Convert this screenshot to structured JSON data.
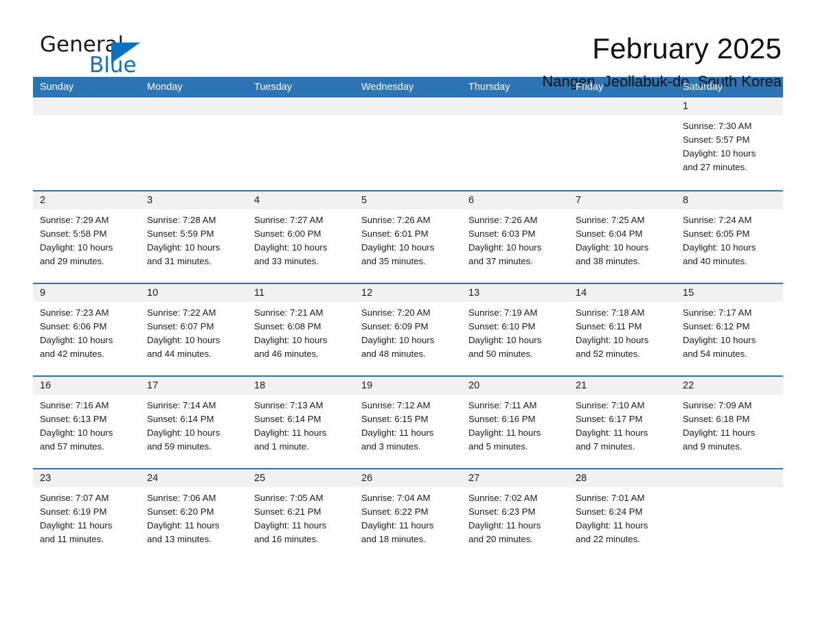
{
  "brand": {
    "name_part1": "General",
    "name_part2": "Blue",
    "accent_color": "#1170bd",
    "triangle_icon": "triangle-icon"
  },
  "header": {
    "title": "February 2025",
    "subtitle": "Nangen, Jeollabuk-do, South Korea",
    "header_bg_color": "#2d74b5",
    "day_band_color": "#f1f1f1"
  },
  "weekday_headers": [
    "Sunday",
    "Monday",
    "Tuesday",
    "Wednesday",
    "Thursday",
    "Friday",
    "Saturday"
  ],
  "weeks": [
    [
      {
        "day": "",
        "sunrise": "",
        "sunset": "",
        "daylight_line1": "",
        "daylight_line2": ""
      },
      {
        "day": "",
        "sunrise": "",
        "sunset": "",
        "daylight_line1": "",
        "daylight_line2": ""
      },
      {
        "day": "",
        "sunrise": "",
        "sunset": "",
        "daylight_line1": "",
        "daylight_line2": ""
      },
      {
        "day": "",
        "sunrise": "",
        "sunset": "",
        "daylight_line1": "",
        "daylight_line2": ""
      },
      {
        "day": "",
        "sunrise": "",
        "sunset": "",
        "daylight_line1": "",
        "daylight_line2": ""
      },
      {
        "day": "",
        "sunrise": "",
        "sunset": "",
        "daylight_line1": "",
        "daylight_line2": ""
      },
      {
        "day": "1",
        "sunrise": "Sunrise: 7:30 AM",
        "sunset": "Sunset: 5:57 PM",
        "daylight_line1": "Daylight: 10 hours",
        "daylight_line2": "and 27 minutes."
      }
    ],
    [
      {
        "day": "2",
        "sunrise": "Sunrise: 7:29 AM",
        "sunset": "Sunset: 5:58 PM",
        "daylight_line1": "Daylight: 10 hours",
        "daylight_line2": "and 29 minutes."
      },
      {
        "day": "3",
        "sunrise": "Sunrise: 7:28 AM",
        "sunset": "Sunset: 5:59 PM",
        "daylight_line1": "Daylight: 10 hours",
        "daylight_line2": "and 31 minutes."
      },
      {
        "day": "4",
        "sunrise": "Sunrise: 7:27 AM",
        "sunset": "Sunset: 6:00 PM",
        "daylight_line1": "Daylight: 10 hours",
        "daylight_line2": "and 33 minutes."
      },
      {
        "day": "5",
        "sunrise": "Sunrise: 7:26 AM",
        "sunset": "Sunset: 6:01 PM",
        "daylight_line1": "Daylight: 10 hours",
        "daylight_line2": "and 35 minutes."
      },
      {
        "day": "6",
        "sunrise": "Sunrise: 7:26 AM",
        "sunset": "Sunset: 6:03 PM",
        "daylight_line1": "Daylight: 10 hours",
        "daylight_line2": "and 37 minutes."
      },
      {
        "day": "7",
        "sunrise": "Sunrise: 7:25 AM",
        "sunset": "Sunset: 6:04 PM",
        "daylight_line1": "Daylight: 10 hours",
        "daylight_line2": "and 38 minutes."
      },
      {
        "day": "8",
        "sunrise": "Sunrise: 7:24 AM",
        "sunset": "Sunset: 6:05 PM",
        "daylight_line1": "Daylight: 10 hours",
        "daylight_line2": "and 40 minutes."
      }
    ],
    [
      {
        "day": "9",
        "sunrise": "Sunrise: 7:23 AM",
        "sunset": "Sunset: 6:06 PM",
        "daylight_line1": "Daylight: 10 hours",
        "daylight_line2": "and 42 minutes."
      },
      {
        "day": "10",
        "sunrise": "Sunrise: 7:22 AM",
        "sunset": "Sunset: 6:07 PM",
        "daylight_line1": "Daylight: 10 hours",
        "daylight_line2": "and 44 minutes."
      },
      {
        "day": "11",
        "sunrise": "Sunrise: 7:21 AM",
        "sunset": "Sunset: 6:08 PM",
        "daylight_line1": "Daylight: 10 hours",
        "daylight_line2": "and 46 minutes."
      },
      {
        "day": "12",
        "sunrise": "Sunrise: 7:20 AM",
        "sunset": "Sunset: 6:09 PM",
        "daylight_line1": "Daylight: 10 hours",
        "daylight_line2": "and 48 minutes."
      },
      {
        "day": "13",
        "sunrise": "Sunrise: 7:19 AM",
        "sunset": "Sunset: 6:10 PM",
        "daylight_line1": "Daylight: 10 hours",
        "daylight_line2": "and 50 minutes."
      },
      {
        "day": "14",
        "sunrise": "Sunrise: 7:18 AM",
        "sunset": "Sunset: 6:11 PM",
        "daylight_line1": "Daylight: 10 hours",
        "daylight_line2": "and 52 minutes."
      },
      {
        "day": "15",
        "sunrise": "Sunrise: 7:17 AM",
        "sunset": "Sunset: 6:12 PM",
        "daylight_line1": "Daylight: 10 hours",
        "daylight_line2": "and 54 minutes."
      }
    ],
    [
      {
        "day": "16",
        "sunrise": "Sunrise: 7:16 AM",
        "sunset": "Sunset: 6:13 PM",
        "daylight_line1": "Daylight: 10 hours",
        "daylight_line2": "and 57 minutes."
      },
      {
        "day": "17",
        "sunrise": "Sunrise: 7:14 AM",
        "sunset": "Sunset: 6:14 PM",
        "daylight_line1": "Daylight: 10 hours",
        "daylight_line2": "and 59 minutes."
      },
      {
        "day": "18",
        "sunrise": "Sunrise: 7:13 AM",
        "sunset": "Sunset: 6:14 PM",
        "daylight_line1": "Daylight: 11 hours",
        "daylight_line2": "and 1 minute."
      },
      {
        "day": "19",
        "sunrise": "Sunrise: 7:12 AM",
        "sunset": "Sunset: 6:15 PM",
        "daylight_line1": "Daylight: 11 hours",
        "daylight_line2": "and 3 minutes."
      },
      {
        "day": "20",
        "sunrise": "Sunrise: 7:11 AM",
        "sunset": "Sunset: 6:16 PM",
        "daylight_line1": "Daylight: 11 hours",
        "daylight_line2": "and 5 minutes."
      },
      {
        "day": "21",
        "sunrise": "Sunrise: 7:10 AM",
        "sunset": "Sunset: 6:17 PM",
        "daylight_line1": "Daylight: 11 hours",
        "daylight_line2": "and 7 minutes."
      },
      {
        "day": "22",
        "sunrise": "Sunrise: 7:09 AM",
        "sunset": "Sunset: 6:18 PM",
        "daylight_line1": "Daylight: 11 hours",
        "daylight_line2": "and 9 minutes."
      }
    ],
    [
      {
        "day": "23",
        "sunrise": "Sunrise: 7:07 AM",
        "sunset": "Sunset: 6:19 PM",
        "daylight_line1": "Daylight: 11 hours",
        "daylight_line2": "and 11 minutes."
      },
      {
        "day": "24",
        "sunrise": "Sunrise: 7:06 AM",
        "sunset": "Sunset: 6:20 PM",
        "daylight_line1": "Daylight: 11 hours",
        "daylight_line2": "and 13 minutes."
      },
      {
        "day": "25",
        "sunrise": "Sunrise: 7:05 AM",
        "sunset": "Sunset: 6:21 PM",
        "daylight_line1": "Daylight: 11 hours",
        "daylight_line2": "and 16 minutes."
      },
      {
        "day": "26",
        "sunrise": "Sunrise: 7:04 AM",
        "sunset": "Sunset: 6:22 PM",
        "daylight_line1": "Daylight: 11 hours",
        "daylight_line2": "and 18 minutes."
      },
      {
        "day": "27",
        "sunrise": "Sunrise: 7:02 AM",
        "sunset": "Sunset: 6:23 PM",
        "daylight_line1": "Daylight: 11 hours",
        "daylight_line2": "and 20 minutes."
      },
      {
        "day": "28",
        "sunrise": "Sunrise: 7:01 AM",
        "sunset": "Sunset: 6:24 PM",
        "daylight_line1": "Daylight: 11 hours",
        "daylight_line2": "and 22 minutes."
      },
      {
        "day": "",
        "sunrise": "",
        "sunset": "",
        "daylight_line1": "",
        "daylight_line2": ""
      }
    ]
  ]
}
